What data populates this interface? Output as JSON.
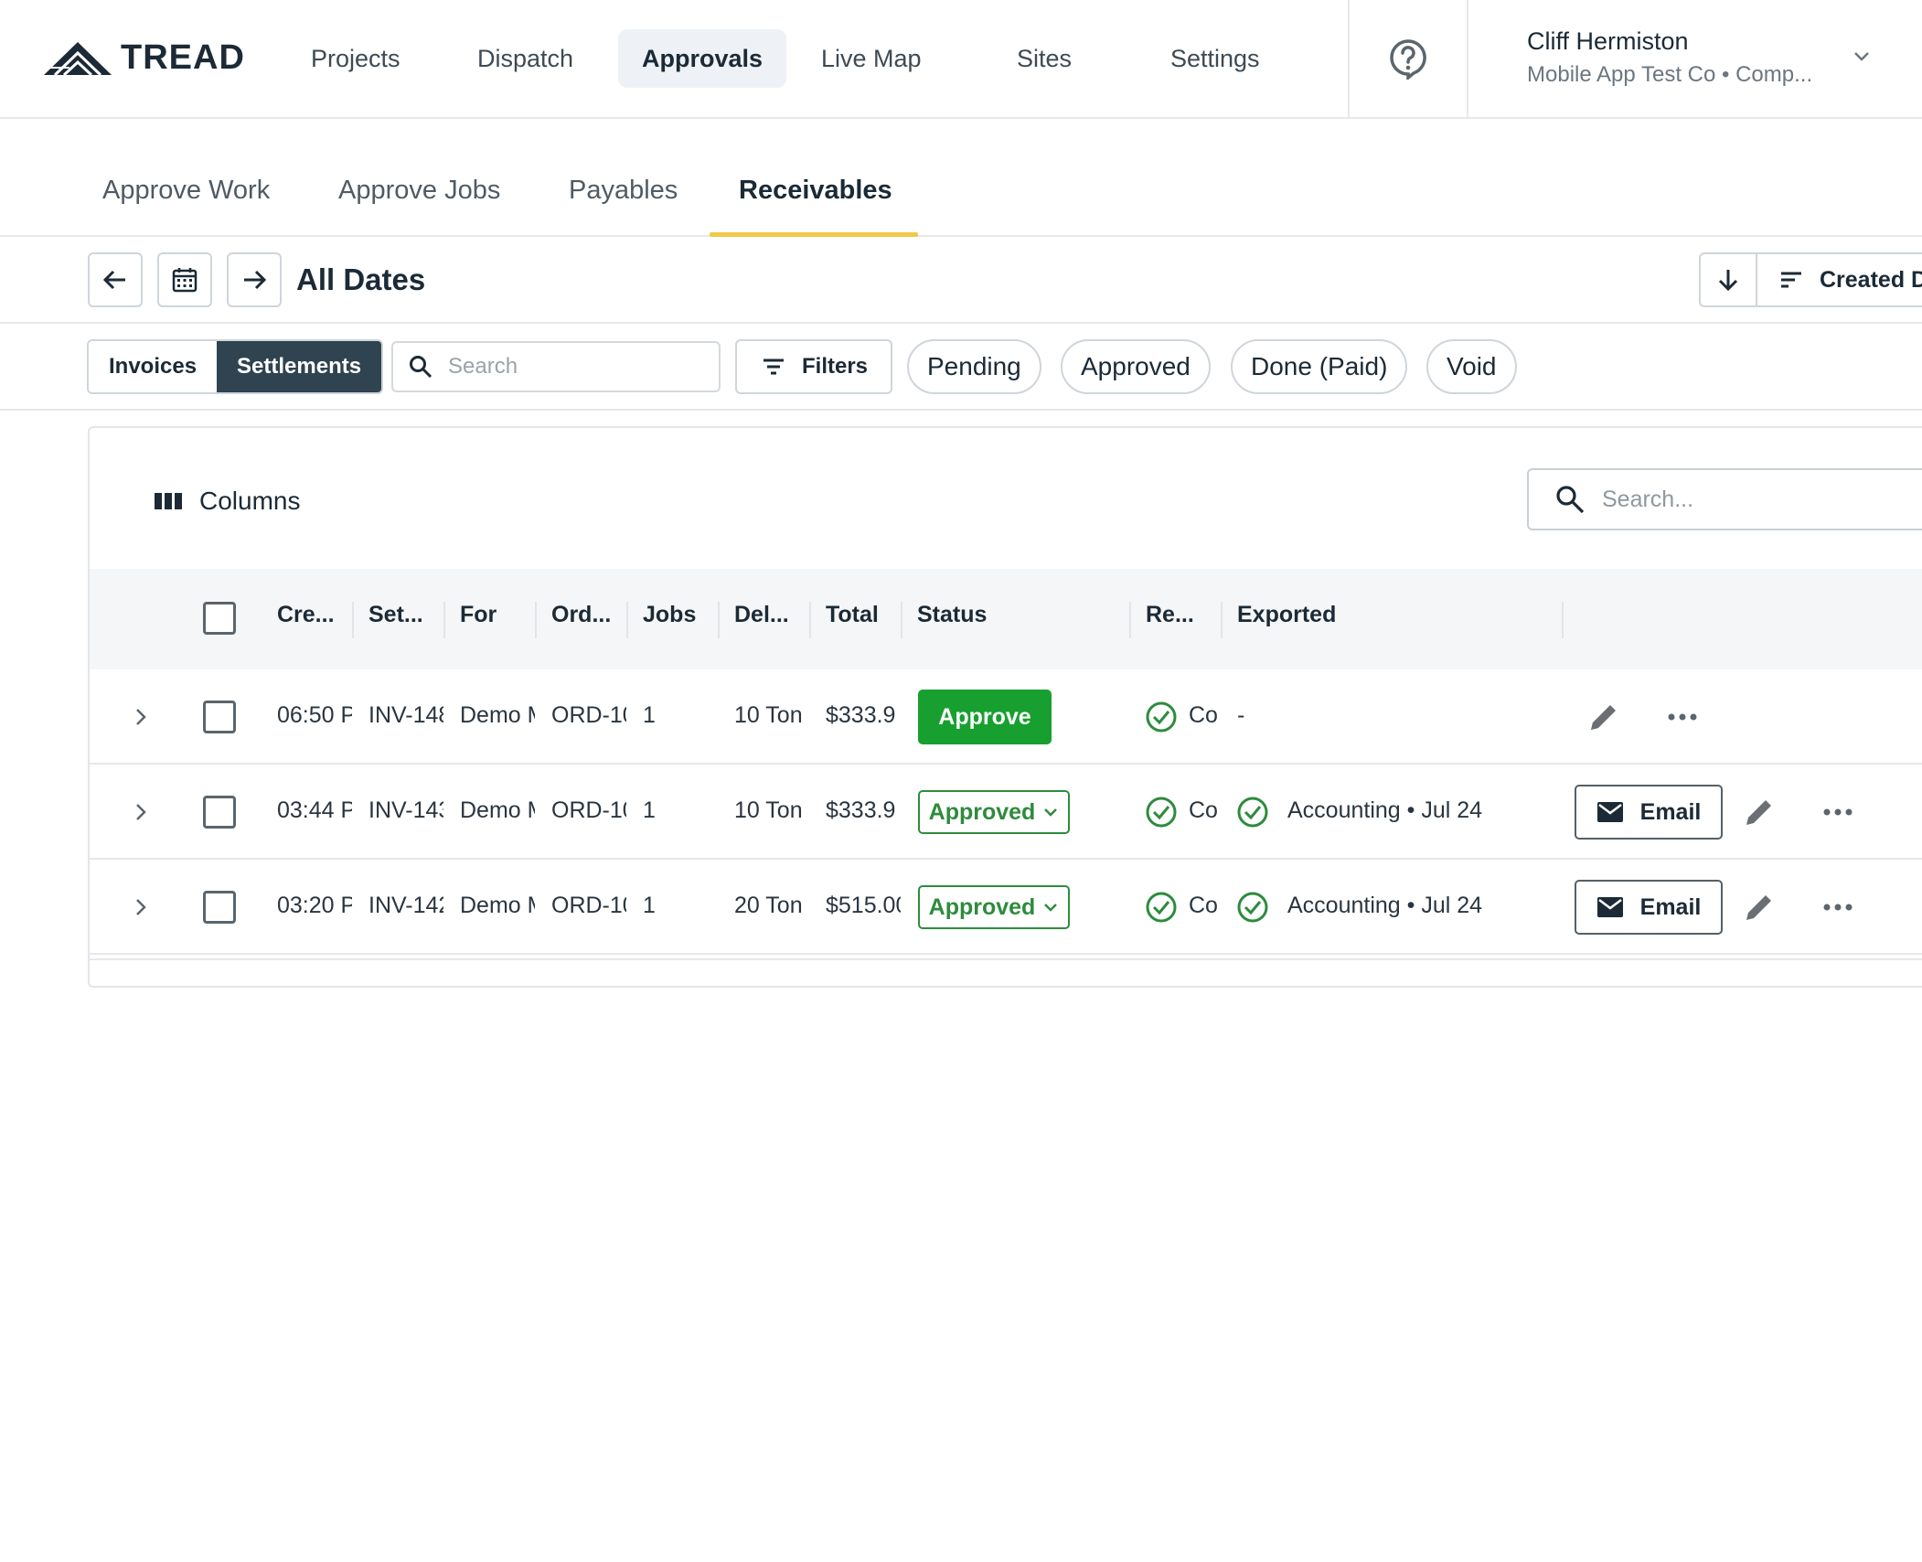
{
  "header": {
    "logo_text": "TREAD",
    "nav": [
      {
        "label": "Projects"
      },
      {
        "label": "Dispatch"
      },
      {
        "label": "Approvals"
      },
      {
        "label": "Live Map"
      },
      {
        "label": "Sites"
      },
      {
        "label": "Settings"
      }
    ],
    "active_nav": "Approvals",
    "user": {
      "name": "Cliff Hermiston",
      "company": "Mobile App Test Co • Comp..."
    }
  },
  "subtabs": {
    "items": [
      {
        "label": "Approve Work"
      },
      {
        "label": "Approve Jobs"
      },
      {
        "label": "Payables"
      },
      {
        "label": "Receivables"
      }
    ],
    "active": "Receivables"
  },
  "date_bar": {
    "title": "All Dates",
    "sort_label": "Created D"
  },
  "filter_bar": {
    "segments": [
      {
        "label": "Invoices"
      },
      {
        "label": "Settlements"
      }
    ],
    "active_segment": "Settlements",
    "search_placeholder": "Search",
    "filters_label": "Filters",
    "chips": [
      {
        "label": "Pending"
      },
      {
        "label": "Approved"
      },
      {
        "label": "Done (Paid)"
      },
      {
        "label": "Void"
      }
    ]
  },
  "table": {
    "columns_label": "Columns",
    "search_placeholder": "Search...",
    "headers": [
      "Cre...",
      "Set...",
      "For",
      "Ord...",
      "Jobs",
      "Del...",
      "Total",
      "Status",
      "Re...",
      "Exported"
    ],
    "rows": [
      {
        "created": "06:50 P",
        "settlement": "INV-148",
        "for": "Demo M",
        "order": "ORD-10",
        "jobs": "1",
        "delivered": "10 Ton",
        "total": "$333.9",
        "status": "Approve",
        "status_kind": "action",
        "received": "Co",
        "exported": "-",
        "has_email": false
      },
      {
        "created": "03:44 P",
        "settlement": "INV-143",
        "for": "Demo M",
        "order": "ORD-10",
        "jobs": "1",
        "delivered": "10 Ton",
        "total": "$333.9",
        "status": "Approved",
        "status_kind": "select",
        "received": "Co",
        "exported": "Accounting • Jul 24",
        "has_email": true,
        "email_label": "Email"
      },
      {
        "created": "03:20 P",
        "settlement": "INV-142",
        "for": "Demo M",
        "order": "ORD-10",
        "jobs": "1",
        "delivered": "20 Ton",
        "total": "$515.00",
        "status": "Approved",
        "status_kind": "select",
        "received": "Co",
        "exported": "Accounting • Jul 24",
        "has_email": true,
        "email_label": "Email"
      }
    ]
  },
  "colors": {
    "brand_dark": "#1b2a36",
    "approve_green": "#17a02f",
    "approved_outline": "#2e8b3d",
    "tab_underline": "#f0c94a",
    "segment_active": "#2f4350"
  }
}
